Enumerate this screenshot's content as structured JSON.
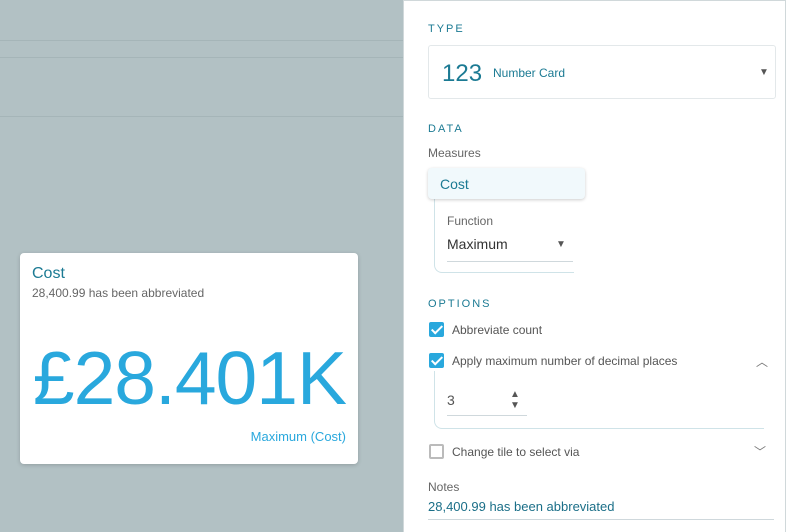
{
  "card": {
    "title": "Cost",
    "subtitle": "28,400.99 has been abbreviated",
    "value": "£28.401K",
    "footer": "Maximum (Cost)"
  },
  "panel": {
    "type_heading": "TYPE",
    "type_icon_text": "123",
    "type_label": "Number Card",
    "data_heading": "DATA",
    "measures_label": "Measures",
    "measure_name": "Cost",
    "function_label": "Function",
    "function_value": "Maximum",
    "options_heading": "OPTIONS",
    "opt_abbreviate": "Abbreviate count",
    "opt_decimals": "Apply maximum number of decimal places",
    "decimals_value": "3",
    "opt_change_tile": "Change tile to select via",
    "notes_label": "Notes",
    "notes_value": "28,400.99 has been abbreviated"
  },
  "colors": {
    "accent": "#29a8dd",
    "teal": "#1b7a93",
    "canvas_bg": "#b2c1c4"
  },
  "icons": [
    "chevron-down-icon",
    "chevron-up-icon",
    "checkbox-checked-icon",
    "checkbox-unchecked-icon",
    "stepper-up-icon",
    "stepper-down-icon"
  ],
  "state": {
    "abbreviate_checked": true,
    "decimals_checked": true,
    "change_tile_checked": false
  }
}
